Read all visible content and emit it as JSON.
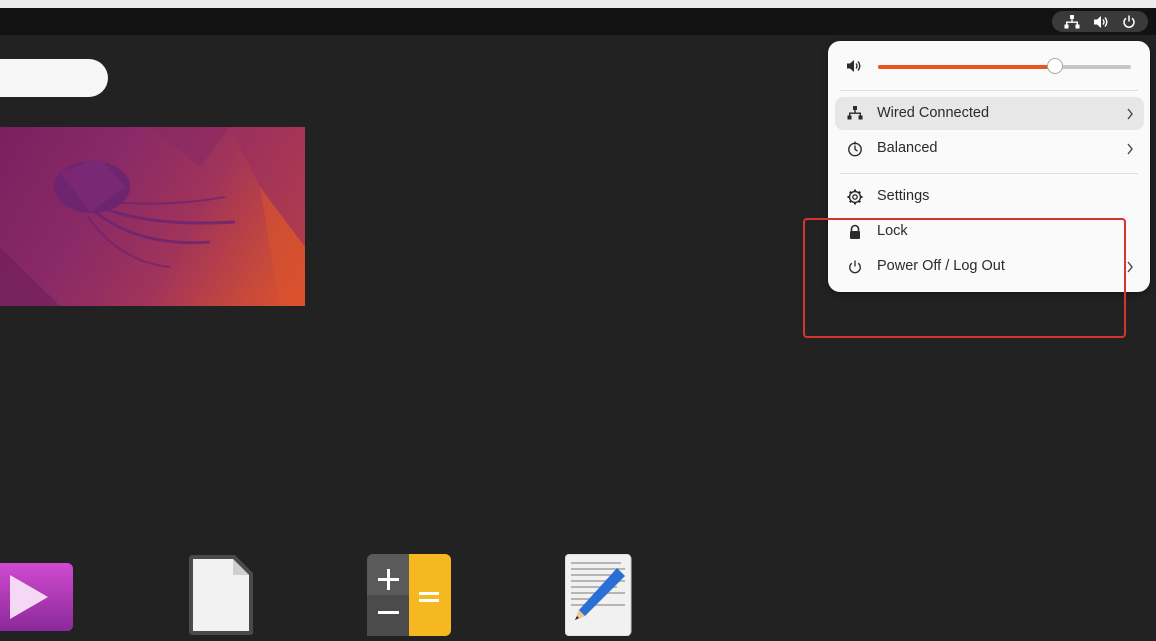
{
  "top_bar": {
    "status_icons": [
      "network-wired-icon",
      "speaker-volume-icon",
      "power-icon"
    ]
  },
  "system_menu": {
    "volume": {
      "icon": "speaker-volume-icon",
      "level": 0.7
    },
    "items": [
      {
        "label": "Wired Connected",
        "icon": "network-wired-icon",
        "has_submenu": true
      },
      {
        "label": "Balanced",
        "icon": "power-profile-icon",
        "has_submenu": true
      },
      {
        "label": "Settings",
        "icon": "gear-icon",
        "has_submenu": false
      },
      {
        "label": "Lock",
        "icon": "lock-icon",
        "has_submenu": false
      },
      {
        "label": "Power Off / Log Out",
        "icon": "power-icon",
        "has_submenu": true
      }
    ]
  },
  "dock_apps": [
    "video-player-app-icon",
    "libreoffice-document-app-icon",
    "calculator-app-icon",
    "text-editor-app-icon"
  ],
  "colors": {
    "accent": "#e95420",
    "annotation": "#d9342c",
    "desktop_bg": "#222222",
    "menu_bg": "#fafafa"
  }
}
